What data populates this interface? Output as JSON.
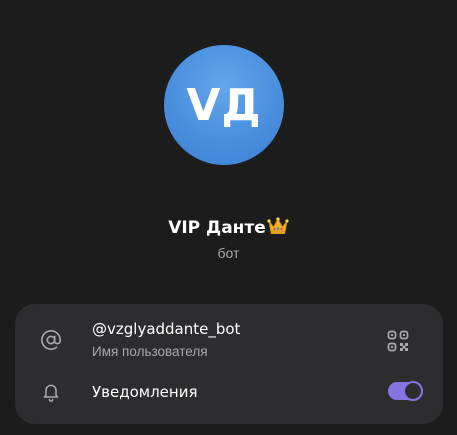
{
  "profile": {
    "avatar_initials": "VД",
    "name": "VIP Данте",
    "name_emoji": "crown-emoji",
    "subtitle": "бот"
  },
  "info": {
    "username": "@vzglyaddante_bot",
    "username_caption": "Имя пользователя",
    "username_icon": "at-icon",
    "qr_icon": "qr-code-icon",
    "notifications_label": "Уведомления",
    "notifications_icon": "bell-icon",
    "notifications_enabled": true
  },
  "colors": {
    "background": "#1c1c1d",
    "card": "#2d2d30",
    "accent": "#8774e1",
    "avatar": "#4a8fde",
    "secondary_text": "#a8a8ad"
  }
}
